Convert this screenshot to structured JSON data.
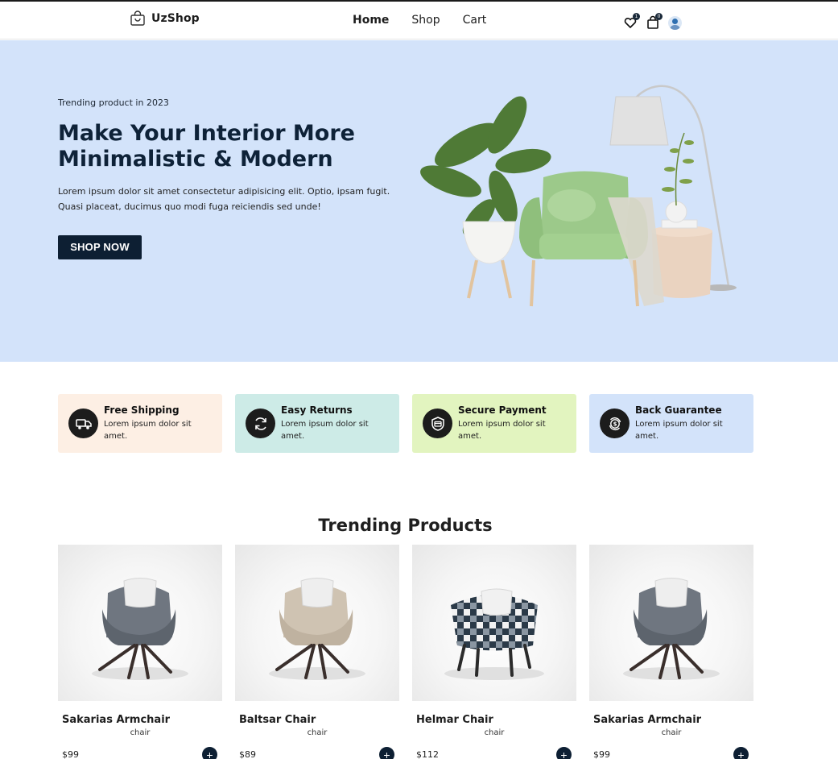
{
  "brand": {
    "name": "UzShop"
  },
  "nav": {
    "links": [
      "Home",
      "Shop",
      "Cart"
    ],
    "active": "Home",
    "wishlist_count": "1",
    "cart_count": "0"
  },
  "hero": {
    "eyebrow": "Trending product in 2023",
    "title": "Make Your Interior More Minimalistic & Modern",
    "description": "Lorem ipsum dolor sit amet consectetur adipisicing elit. Optio, ipsam fugit. Quasi placeat, ducimus quo modi fuga reiciendis sed unde!",
    "cta": "SHOP NOW"
  },
  "features": [
    {
      "title": "Free Shipping",
      "desc": "Lorem ipsum dolor sit amet.",
      "icon": "truck-icon",
      "bg": "#fdefe4"
    },
    {
      "title": "Easy Returns",
      "desc": "Lorem ipsum dolor sit amet.",
      "icon": "refresh-icon",
      "bg": "#cdebe7"
    },
    {
      "title": "Secure Payment",
      "desc": "Lorem ipsum dolor sit amet.",
      "icon": "secure-payment-icon",
      "bg": "#e2f4bf"
    },
    {
      "title": "Back Guarantee",
      "desc": "Lorem ipsum dolor sit amet.",
      "icon": "money-back-icon",
      "bg": "#d3e3fa"
    }
  ],
  "trending": {
    "title": "Trending Products",
    "products": [
      {
        "name": "Sakarias Armchair",
        "category": "chair",
        "price": "$99",
        "color": "#6f7680"
      },
      {
        "name": "Baltsar Chair",
        "category": "chair",
        "price": "$89",
        "color": "#cfc3b2"
      },
      {
        "name": "Helmar Chair",
        "category": "chair",
        "price": "$112",
        "color": "#2b3a48"
      },
      {
        "name": "Sakarias Armchair",
        "category": "chair",
        "price": "$99",
        "color": "#6f7680"
      }
    ],
    "add_symbol": "+"
  },
  "colors": {
    "hero_bg": "#d3e3fa",
    "primary_dark": "#0d1f33"
  }
}
